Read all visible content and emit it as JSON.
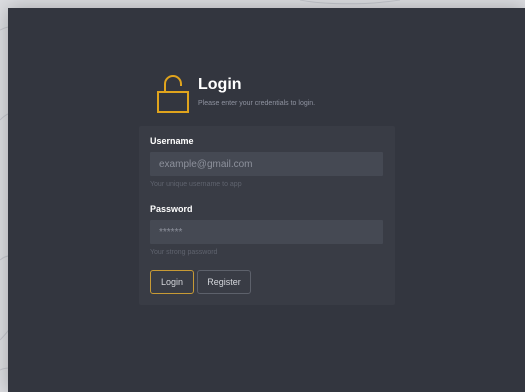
{
  "header": {
    "title": "Login",
    "subtitle": "Please enter your credentials to login.",
    "icon": "lock-open-icon",
    "icon_color": "#e0a41d"
  },
  "form": {
    "username": {
      "label": "Username",
      "value": "",
      "placeholder": "example@gmail.com",
      "hint": "Your unique username to app"
    },
    "password": {
      "label": "Password",
      "value": "",
      "placeholder": "******",
      "hint": "Your strong password"
    },
    "login_label": "Login",
    "register_label": "Register"
  },
  "colors": {
    "panel_bg": "#33363f",
    "card_bg": "#393c45",
    "input_bg": "#454953",
    "accent": "#c79a35",
    "page_bg": "#dcdde1"
  }
}
